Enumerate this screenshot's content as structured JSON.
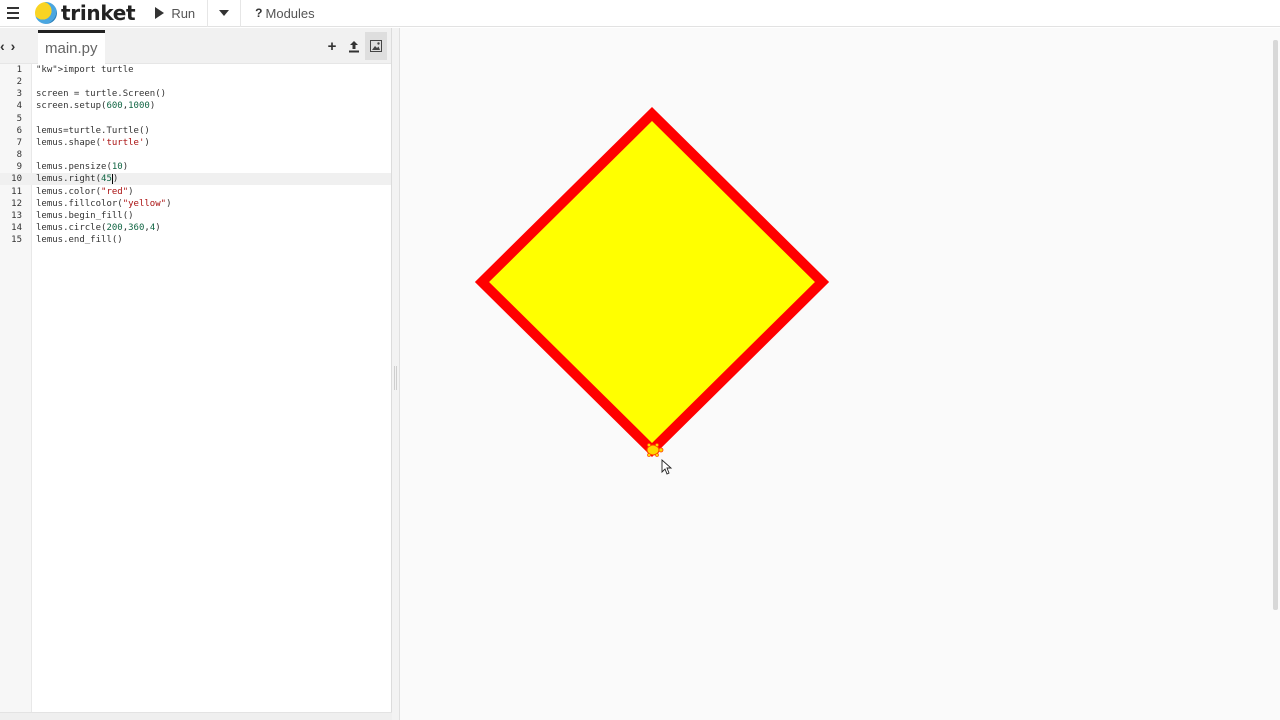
{
  "app": {
    "brand": "trinket",
    "run_label": "Run",
    "modules_label": "Modules",
    "modules_glyph": "?"
  },
  "editor": {
    "nav_left": "‹",
    "nav_right": "›",
    "tab_name": "main.py",
    "tools": [
      {
        "icon": "plus-icon",
        "glyph": "+"
      },
      {
        "icon": "upload-icon",
        "glyph": "⤒"
      },
      {
        "icon": "image-icon",
        "glyph": "▣"
      }
    ],
    "active_line": 10,
    "lines": [
      {
        "n": "1",
        "text": "import turtle"
      },
      {
        "n": "2",
        "text": ""
      },
      {
        "n": "3",
        "text": "screen = turtle.Screen()"
      },
      {
        "n": "4",
        "text": "screen.setup(600,1000)"
      },
      {
        "n": "5",
        "text": ""
      },
      {
        "n": "6",
        "text": "lemus=turtle.Turtle()"
      },
      {
        "n": "7",
        "text": "lemus.shape('turtle')"
      },
      {
        "n": "8",
        "text": ""
      },
      {
        "n": "9",
        "text": "lemus.pensize(10)"
      },
      {
        "n": "10",
        "text": "lemus.right(45)"
      },
      {
        "n": "11",
        "text": "lemus.color(\"red\")"
      },
      {
        "n": "12",
        "text": "lemus.fillcolor(\"yellow\")"
      },
      {
        "n": "13",
        "text": "lemus.begin_fill()"
      },
      {
        "n": "14",
        "text": "lemus.circle(200,360,4)"
      },
      {
        "n": "15",
        "text": "lemus.end_fill()"
      }
    ]
  },
  "output": {
    "pen_color": "#ff0000",
    "fill_color": "#ffff00",
    "pen_size": 10,
    "shape": "diamond"
  }
}
